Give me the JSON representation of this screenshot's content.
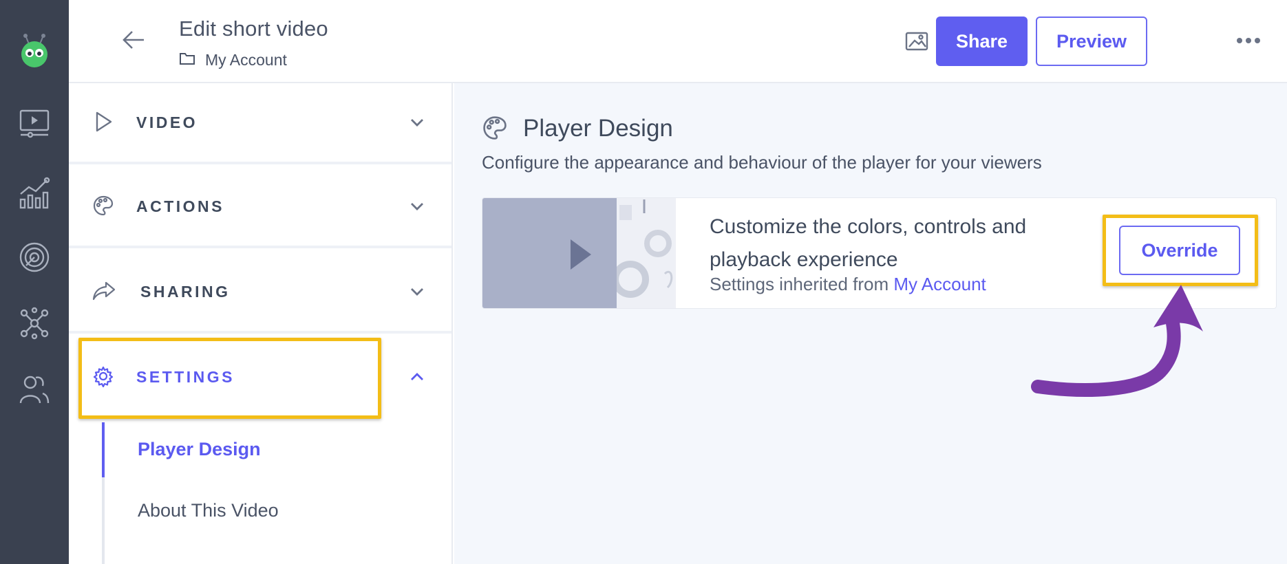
{
  "header": {
    "title": "Edit short video",
    "breadcrumb": "My Account",
    "share_label": "Share",
    "preview_label": "Preview"
  },
  "rail": {
    "items": [
      "logo-icon",
      "video-library-icon",
      "analytics-icon",
      "target-icon",
      "integrations-icon",
      "users-icon"
    ]
  },
  "sidebar": {
    "sections": [
      {
        "label": "VIDEO",
        "icon": "play-outline-icon",
        "expanded": false
      },
      {
        "label": "ACTIONS",
        "icon": "palette-icon",
        "expanded": false
      },
      {
        "label": "SHARING",
        "icon": "share-arrow-icon",
        "expanded": false
      },
      {
        "label": "SETTINGS",
        "icon": "gear-icon",
        "expanded": true
      }
    ],
    "sub_items": [
      {
        "label": "Player Design",
        "active": true
      },
      {
        "label": "About This Video",
        "active": false
      }
    ]
  },
  "main": {
    "title": "Player Design",
    "description": "Configure the appearance and behaviour of the player for your viewers",
    "card": {
      "title": "Customize the colors, controls and playback experience",
      "subtitle_prefix": "Settings inherited from ",
      "subtitle_link": "My Account",
      "button_label": "Override"
    }
  },
  "colors": {
    "rail": "#3a4150",
    "accent": "#5f5ef0",
    "highlight": "#f3bd17",
    "annotation_arrow": "#7a3aa8",
    "main_bg": "#f4f7fc"
  }
}
